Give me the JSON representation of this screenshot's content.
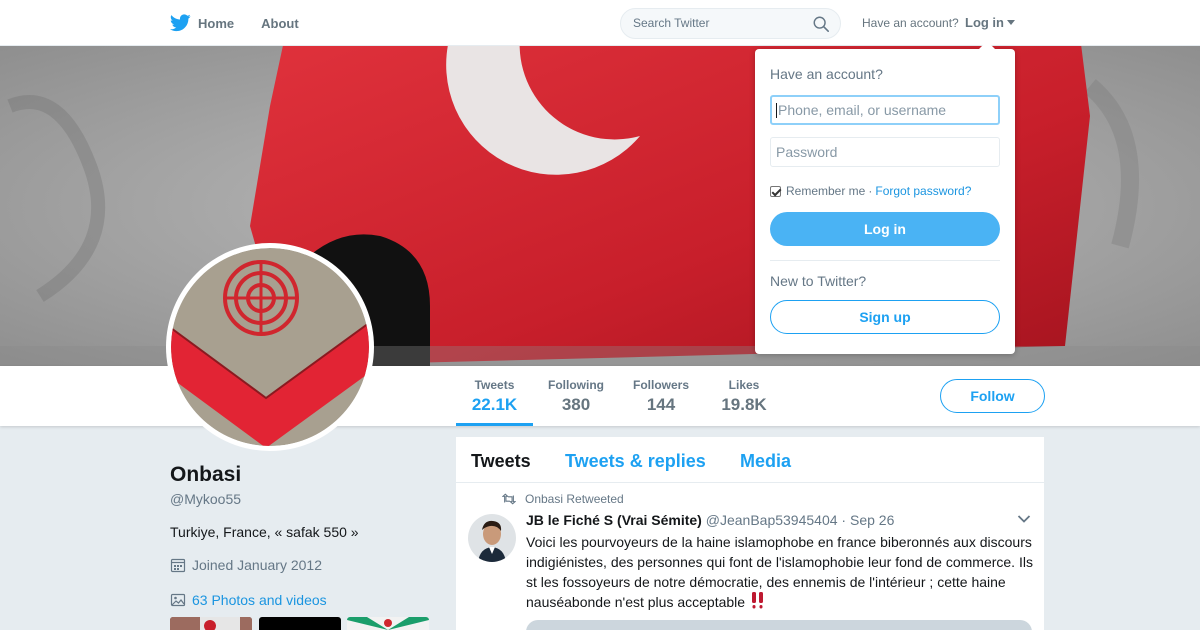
{
  "nav": {
    "home_label": "Home",
    "about_label": "About",
    "search_placeholder": "Search Twitter",
    "have_account": "Have an account?",
    "login_label": "Log in"
  },
  "stats": {
    "tweets": {
      "label": "Tweets",
      "value": "22.1K"
    },
    "following": {
      "label": "Following",
      "value": "380"
    },
    "followers": {
      "label": "Followers",
      "value": "144"
    },
    "likes": {
      "label": "Likes",
      "value": "19.8K"
    },
    "follow_button": "Follow"
  },
  "profile": {
    "name": "Onbasi",
    "handle": "@Mykoo55",
    "bio": "Turkiye, France, « safak 550 »",
    "joined": "Joined January 2012",
    "photos_link": "63 Photos and videos"
  },
  "timeline": {
    "tabs": [
      "Tweets",
      "Tweets & replies",
      "Media"
    ],
    "active_tab": "Tweets",
    "tweet": {
      "retweeted_by": "Onbasi Retweeted",
      "author_name": "JB le Fiché S (Vrai Sémite)",
      "author_handle": "@JeanBap53945404",
      "separator": "·",
      "date": "Sep 26",
      "text": "Voici les pourvoyeurs de la haine islamophobe en france biberonnés aux discours indigiénistes, des personnes qui font de l'islamophobie leur fond de commerce. Ils st les fossoyeurs de notre démocratie, des ennemis de l'intérieur ; cette haine nauséabonde n'est plus acceptable",
      "emoji": "‼️"
    }
  },
  "login_dropdown": {
    "title": "Have an account?",
    "username_placeholder": "Phone, email, or username",
    "password_placeholder": "Password",
    "remember_me": "Remember me",
    "separator": "·",
    "forgot_password": "Forgot password?",
    "login_button": "Log in",
    "new_to_twitter": "New to Twitter?",
    "signup_button": "Sign up",
    "remember_checked": true
  },
  "colors": {
    "accent": "#1da1f2",
    "login_button": "#4ab3f4",
    "page_background": "#e6ecf0",
    "banner_flag_red": "#d52230"
  },
  "icons": [
    "twitter-bird-icon",
    "home-icon",
    "search-icon",
    "caret-down-icon",
    "calendar-icon",
    "photo-icon",
    "retweet-icon",
    "chevron-down-icon",
    "double-exclamation-icon"
  ]
}
